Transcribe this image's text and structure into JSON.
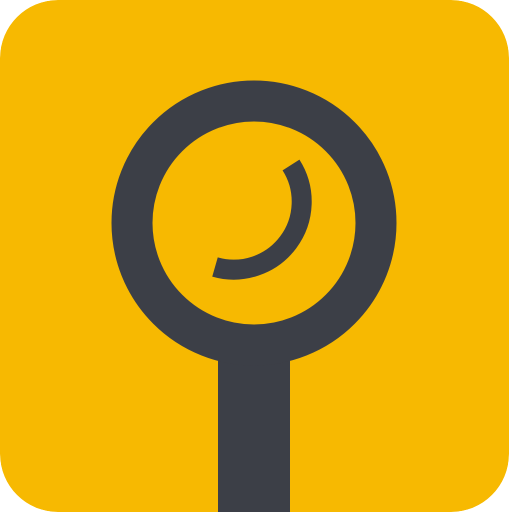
{
  "icon": {
    "semantic": "magnifier-icon",
    "background_color": "#F7B901",
    "glyph_color": "#3C3F47"
  }
}
